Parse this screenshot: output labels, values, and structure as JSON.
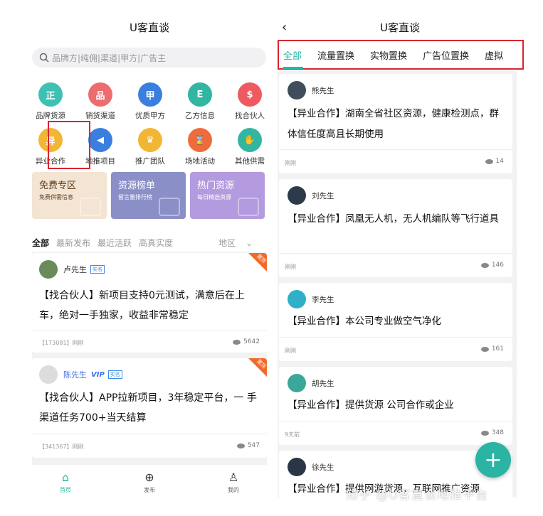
{
  "left": {
    "title": "U客直谈",
    "search_placeholder": "品牌方|纯佣|渠道|甲方|广告主",
    "categories": [
      {
        "label": "品牌货源",
        "icon": "shield-icon",
        "glyph": "正",
        "color": "#3cc1b4"
      },
      {
        "label": "销货渠道",
        "icon": "network-icon",
        "glyph": "品",
        "color": "#ee6b6e"
      },
      {
        "label": "优质甲方",
        "icon": "jia-badge-icon",
        "glyph": "甲",
        "color": "#3a7fe0"
      },
      {
        "label": "乙方信息",
        "icon": "document-icon",
        "glyph": "E",
        "color": "#33b6a1"
      },
      {
        "label": "找合伙人",
        "icon": "money-bag-icon",
        "glyph": "$",
        "color": "#ee5a5f"
      },
      {
        "label": "异业合作",
        "icon": "yi-coin-icon",
        "glyph": "异",
        "color": "#f3b534"
      },
      {
        "label": "地推项目",
        "icon": "megaphone-icon",
        "glyph": "◀",
        "color": "#3a7fe0"
      },
      {
        "label": "推广团队",
        "icon": "crown-icon",
        "glyph": "♛",
        "color": "#f3b534"
      },
      {
        "label": "场地活动",
        "icon": "hourglass-icon",
        "glyph": "⌛",
        "color": "#ee6b3c"
      },
      {
        "label": "其他供需",
        "icon": "handshake-icon",
        "glyph": "✋",
        "color": "#33b6a1"
      }
    ],
    "promos": [
      {
        "title": "免费专区",
        "subtitle": "免费供需信息",
        "bg": "#f4e4d3",
        "fg": "#5a3b1a"
      },
      {
        "title": "资源榜单",
        "subtitle": "留言量排行榜",
        "bg": "#8a8fc8",
        "fg": "#ffffff"
      },
      {
        "title": "热门资源",
        "subtitle": "每日精选资源",
        "bg": "#b49ade",
        "fg": "#ffffff"
      }
    ],
    "filters": [
      "全部",
      "最新发布",
      "最近活跃",
      "高真实度"
    ],
    "region": "地区",
    "posts": [
      {
        "user": "卢先生",
        "badge": "实名",
        "vip": "",
        "corner": "置顶",
        "body": "【找合伙人】新项目支持0元测试，满意后在上车，绝对一手独家，收益非常稳定",
        "meta": "【173081】刚刚",
        "views": "5642"
      },
      {
        "user": "陈先生",
        "badge": "实名",
        "vip": "VIP",
        "corner": "置顶",
        "body": "【找合伙人】APP拉新项目，3年稳定平台，一 手渠道任务700+当天结算",
        "meta": "【341367】刚刚",
        "views": "547"
      }
    ],
    "tabbar": [
      {
        "label": "首页",
        "icon": "home-icon",
        "glyph": "⌂"
      },
      {
        "label": "发布",
        "icon": "plus-circle-icon",
        "glyph": "⊕"
      },
      {
        "label": "我的",
        "icon": "user-icon",
        "glyph": "♙"
      }
    ]
  },
  "right": {
    "back": "‹",
    "title": "U客直谈",
    "tabs": [
      "全部",
      "流量置换",
      "实物置换",
      "广告位置换",
      "虚拟"
    ],
    "posts": [
      {
        "user": "熊先生",
        "body": "【异业合作】湖南全省社区资源，健康检测点，群体信任度高且长期使用",
        "time": "刚刚",
        "views": "14"
      },
      {
        "user": "刘先生",
        "body": "【异业合作】凤凰无人机，无人机编队等飞行道具",
        "time": "刚刚",
        "views": "146"
      },
      {
        "user": "李先生",
        "body": "【异业合作】本公司专业做空气净化",
        "time": "刚刚",
        "views": "161"
      },
      {
        "user": "胡先生",
        "body": "【异业合作】提供货源 公司合作或企业",
        "time": "9天前",
        "views": "348"
      },
      {
        "user": "徐先生",
        "body": "【异业合作】提供网游货源，互联网推广资源",
        "time": "",
        "views": ""
      }
    ],
    "fab": "+",
    "watermark": "知乎 @U客直谈地推平台"
  },
  "colors": {
    "accent": "#2bb3a3",
    "highlight": "#d7262e",
    "corner_tag": "#f06a2b"
  }
}
